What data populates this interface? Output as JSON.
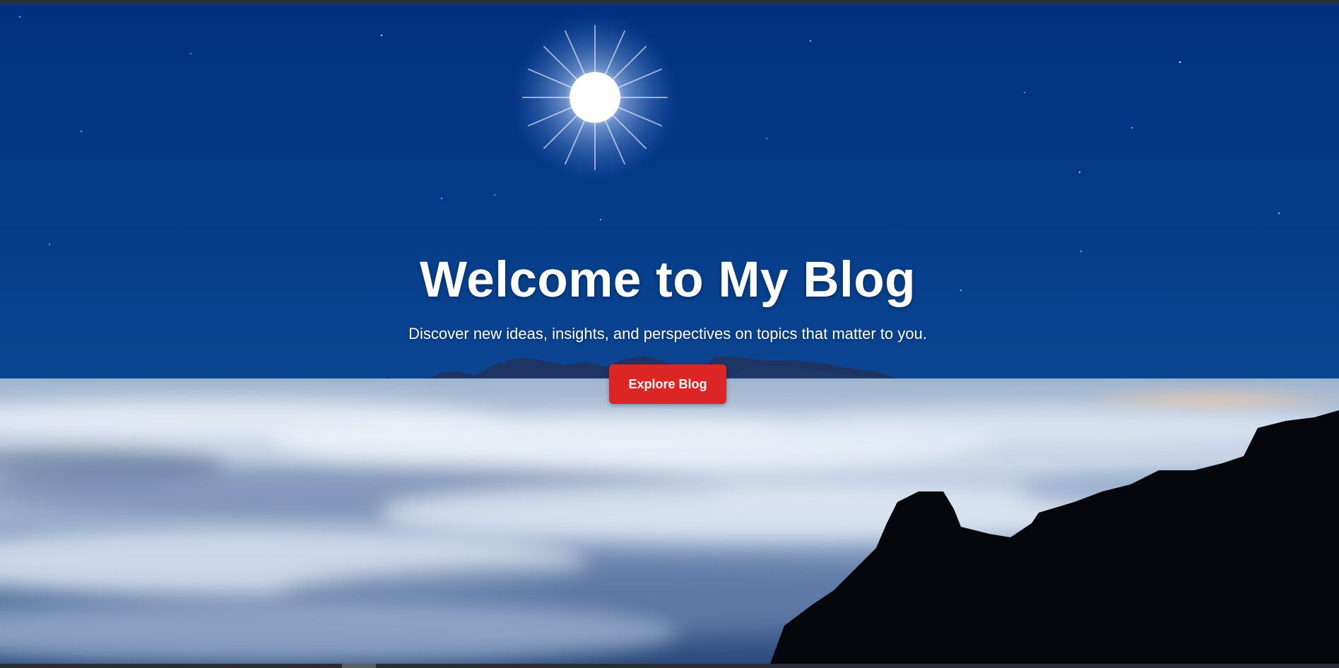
{
  "hero": {
    "title": "Welcome to My Blog",
    "subtitle": "Discover new ideas, insights, and perspectives on topics that matter to you.",
    "cta_label": "Explore Blog"
  },
  "colors": {
    "sky_top": "#00328a",
    "sky_bottom": "#0d4a9a",
    "button": "#dc2626",
    "text": "#ffffff"
  }
}
